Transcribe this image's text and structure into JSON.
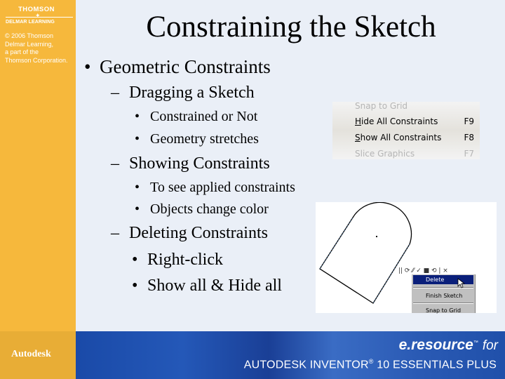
{
  "sidebar": {
    "brand_name": "THOMSON",
    "brand_sub": "DELMAR LEARNING",
    "copyright_lines": [
      "© 2006 Thomson",
      "Delmar Learning,",
      "a part of the",
      "Thomson Corporation."
    ],
    "footer_logo": "Autodesk"
  },
  "footer": {
    "eresource": "e.resource",
    "trademark": "™",
    "for": "for",
    "title_a": "AUTODESK INVENTOR",
    "registered": "®",
    "title_b": " 10 ESSENTIALS PLUS"
  },
  "slide": {
    "title": "Constraining the Sketch",
    "bullets": [
      {
        "level": 1,
        "marker": "•",
        "text": "Geometric Constraints"
      },
      {
        "level": 2,
        "marker": "–",
        "text": "Dragging a Sketch"
      },
      {
        "level": 3,
        "marker": "•",
        "text": "Constrained or Not"
      },
      {
        "level": 3,
        "marker": "•",
        "text": "Geometry stretches"
      },
      {
        "level": 2,
        "marker": "–",
        "text": "Showing Constraints"
      },
      {
        "level": 3,
        "marker": "•",
        "text": "To see applied constraints"
      },
      {
        "level": 3,
        "marker": "•",
        "text": "Objects change color"
      },
      {
        "level": 2,
        "marker": "–",
        "text": "Deleting Constraints"
      },
      {
        "level": 2,
        "marker": "•",
        "text": "Right-click"
      },
      {
        "level": 2,
        "marker": "•",
        "text": "Show all & Hide all"
      }
    ]
  },
  "menu_screenshot": {
    "items": [
      {
        "label": "Snap to Grid",
        "shortcut": "",
        "disabled": true
      },
      {
        "label_u": "H",
        "label_rest": "ide All Constraints",
        "shortcut": "F9",
        "disabled": false
      },
      {
        "label_u": "S",
        "label_rest": "how All Constraints",
        "shortcut": "F8",
        "disabled": false
      },
      {
        "label": "Slice Graphics",
        "shortcut": "F7",
        "disabled": true
      }
    ]
  },
  "sketch_screenshot": {
    "toolbar_glyphs": "|| ⟳ ⁄⁄ ✓ ■ ⟲ | ×",
    "context_menu": [
      {
        "label": "Delete",
        "selected": true
      },
      {
        "label": "Finish Sketch",
        "selected": false
      },
      {
        "label": "Snap to Grid",
        "selected": false
      }
    ]
  }
}
